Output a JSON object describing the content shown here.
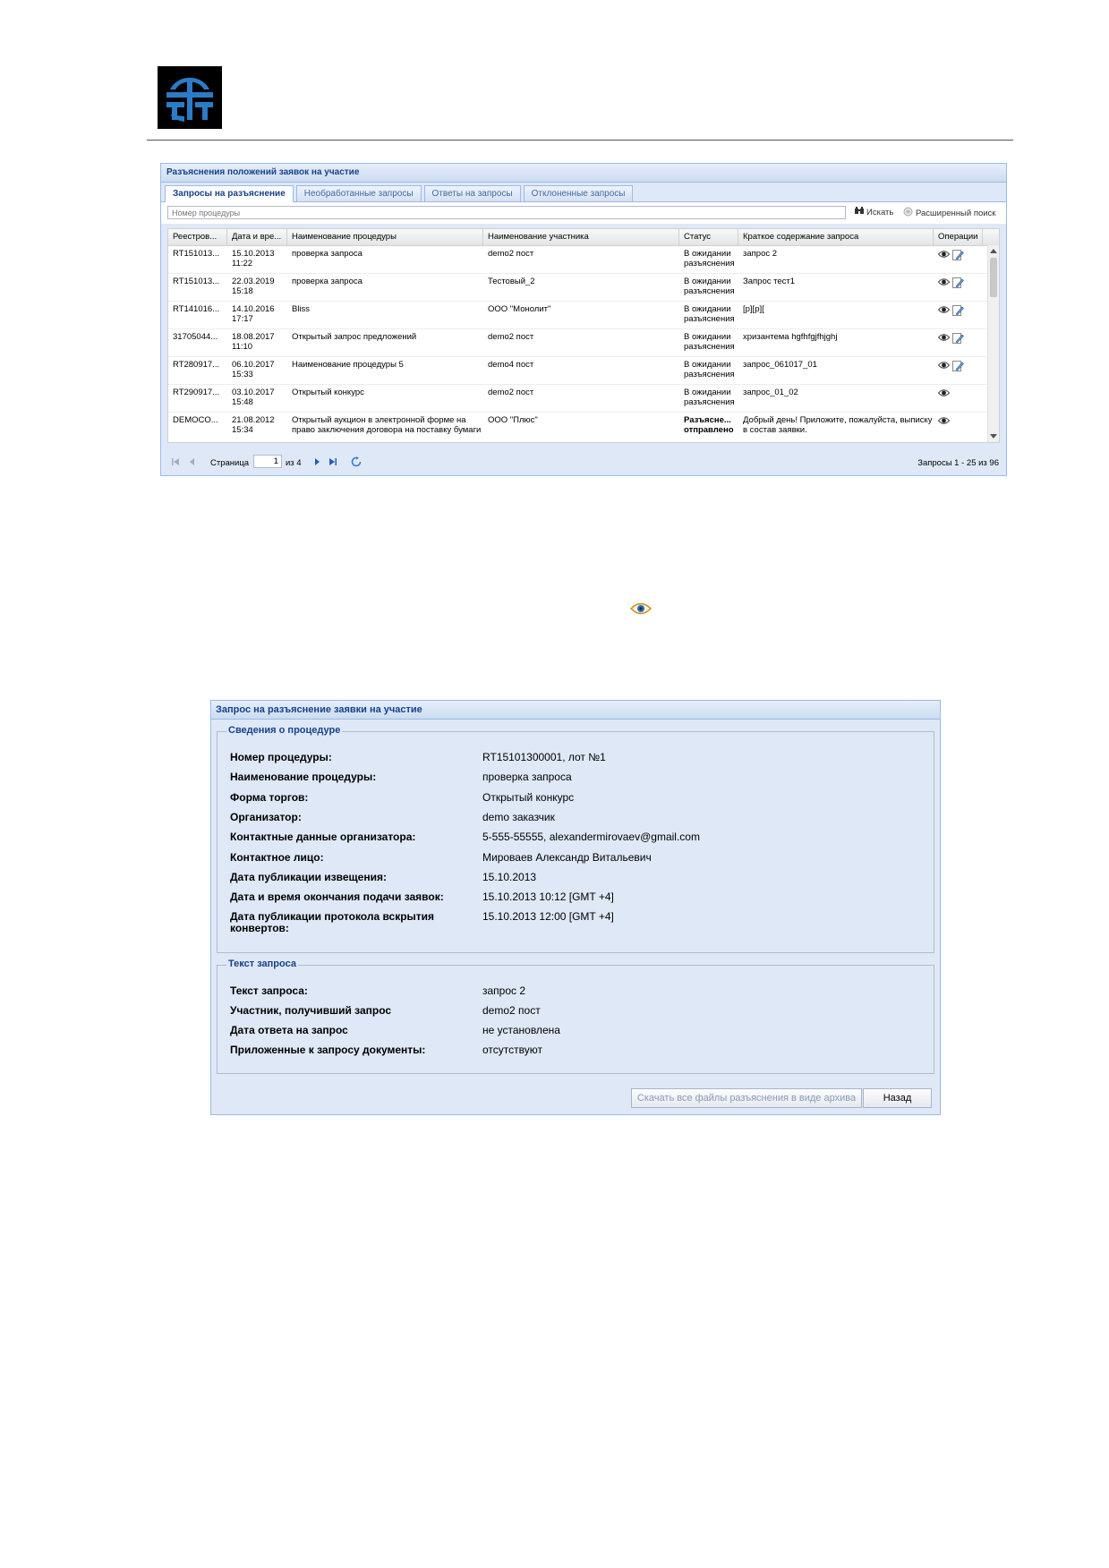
{
  "grid": {
    "title": "Разъяснения положений заявок на участие",
    "tabs": [
      "Запросы на разъяснение",
      "Необработанные запросы",
      "Ответы на запросы",
      "Отклоненные запросы"
    ],
    "search": {
      "placeholder": "Номер процедуры",
      "search_label": "Искать",
      "advanced_label": "Расширенный поиск"
    },
    "columns": [
      "Реестров...",
      "Дата и вре...",
      "Наименование процедуры",
      "Наименование участника",
      "Статус",
      "Краткое содержание запроса",
      "Операции"
    ],
    "rows": [
      {
        "reg": "RT151013...",
        "date": "15.10.2013",
        "time": "11:22",
        "procedure": "проверка запроса",
        "participant": "demo2 пост",
        "status1": "В ожидании",
        "status2": "разъяснения",
        "summary": "запрос 2",
        "edit": true
      },
      {
        "reg": "RT151013...",
        "date": "22.03.2019",
        "time": "15:18",
        "procedure": "проверка запроса",
        "participant": "Тестовый_2",
        "status1": "В ожидании",
        "status2": "разъяснения",
        "summary": "Запрос тест1",
        "edit": true
      },
      {
        "reg": "RT141016...",
        "date": "14.10.2016",
        "time": "17:17",
        "procedure": "Bliss",
        "participant": "ООО \"Монолит\"",
        "status1": "В ожидании",
        "status2": "разъяснения",
        "summary": "[p][p][",
        "edit": true
      },
      {
        "reg": "31705044...",
        "date": "18.08.2017",
        "time": "11:10",
        "procedure": "Открытый запрос предложений",
        "participant": "demo2 пост",
        "status1": "В ожидании",
        "status2": "разъяснения",
        "summary": "хризантема hgfhfgjfhjghj",
        "edit": true
      },
      {
        "reg": "RT280917...",
        "date": "06.10.2017",
        "time": "15:33",
        "procedure": "Наименование процедуры 5",
        "participant": "demo4 пост",
        "status1": "В ожидании",
        "status2": "разъяснения",
        "summary": "запрос_061017_01",
        "edit": true
      },
      {
        "reg": "RT290917...",
        "date": "03.10.2017",
        "time": "15:48",
        "procedure": "Открытый конкурс",
        "participant": "demo2 пост",
        "status1": "В ожидании",
        "status2": "разъяснения",
        "summary": "запрос_01_02",
        "edit": false
      },
      {
        "reg": "DEMOCO...",
        "date": "21.08.2012",
        "time": "15:34",
        "procedure": "Открытый аукцион в электронной форме на право заключения договора на поставку бумаги",
        "participant": "ООО \"Плюс\"",
        "status1": "Разъясне...",
        "status2": "отправлено",
        "summary": "Добрый день! Приложите, пожалуйста, выписку в состав заявки.",
        "edit": false
      }
    ],
    "pager": {
      "page_label": "Страница",
      "page_value": "1",
      "of_label": "из 4",
      "summary": "Запросы 1 - 25 из 96"
    }
  },
  "detail": {
    "title": "Запрос на разъяснение заявки на участие",
    "procedure_section": {
      "legend": "Сведения о процедуре",
      "fields": [
        {
          "label": "Номер процедуры:",
          "value": "RT15101300001, лот №1"
        },
        {
          "label": "Наименование процедуры:",
          "value": "проверка запроса"
        },
        {
          "label": "Форма торгов:",
          "value": "Открытый конкурс"
        },
        {
          "label": "Организатор:",
          "value": "demo заказчик"
        },
        {
          "label": "Контактные данные организатора:",
          "value": "5-555-55555, alexandermirovaev@gmail.com"
        },
        {
          "label": "Контактное лицо:",
          "value": "Мироваев Александр Витальевич"
        },
        {
          "label": "Дата публикации извещения:",
          "value": "15.10.2013"
        },
        {
          "label": "Дата и время окончания подачи заявок:",
          "value": "15.10.2013 10:12 [GMT +4]"
        },
        {
          "label": "Дата публикации протокола вскрытия конвертов:",
          "value": "15.10.2013 12:00 [GMT +4]"
        }
      ]
    },
    "request_section": {
      "legend": "Текст запроса",
      "fields": [
        {
          "label": "Текст запроса:",
          "value": "запрос 2"
        },
        {
          "label": "Участник, получивший запрос",
          "value": "demo2 пост"
        },
        {
          "label": "Дата ответа на запрос",
          "value": "не установлена"
        },
        {
          "label": "Приложенные к запросу документы:",
          "value": "отсутствуют"
        }
      ]
    },
    "buttons": {
      "download": "Скачать все файлы разъяснения в виде архива",
      "back": "Назад"
    }
  },
  "colors": {
    "panel_bg": "#dfe8f6",
    "panel_border": "#99bbe8",
    "title_text": "#15428b",
    "status_sent": "#2b8a00"
  },
  "icons": [
    "company-logo",
    "binoculars-icon",
    "advanced-search-icon",
    "eye-icon",
    "edit-icon",
    "first-page-icon",
    "prev-page-icon",
    "next-page-icon",
    "last-page-icon",
    "refresh-icon"
  ]
}
